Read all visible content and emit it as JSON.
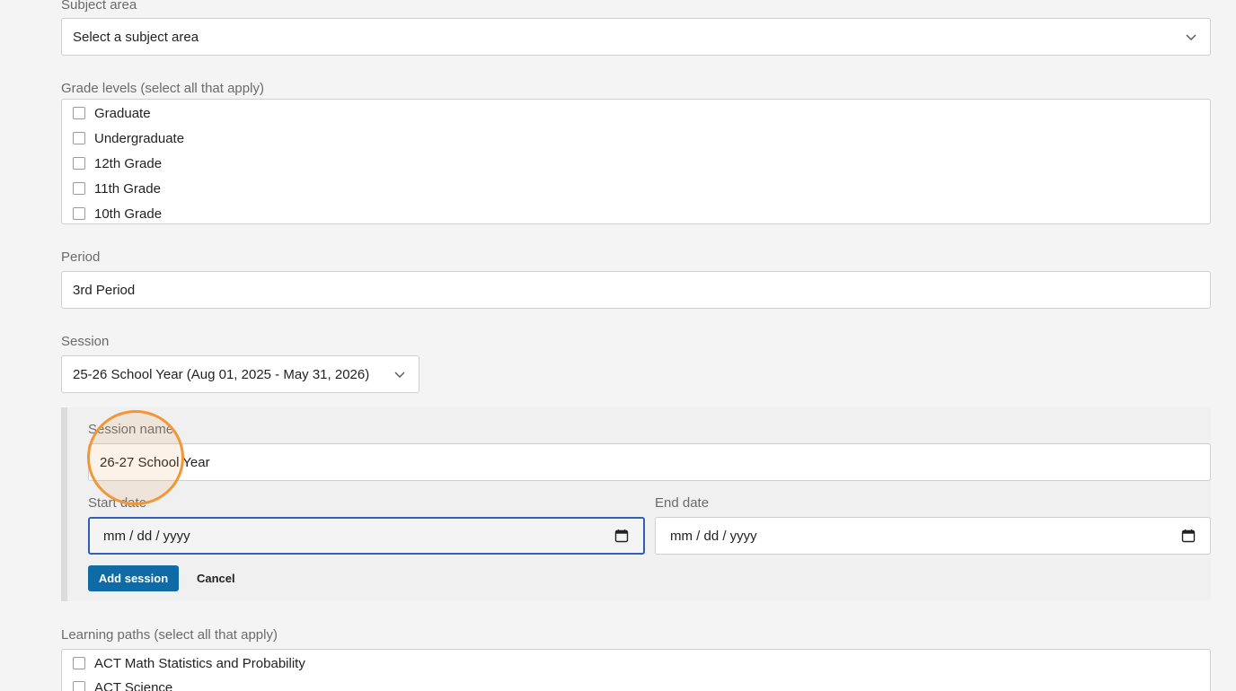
{
  "subject_area": {
    "label": "Subject area",
    "value": "Select a subject area"
  },
  "grade_levels": {
    "label": "Grade levels (select all that apply)",
    "items": [
      "Graduate",
      "Undergraduate",
      "12th Grade",
      "11th Grade",
      "10th Grade"
    ]
  },
  "period": {
    "label": "Period",
    "value": "3rd Period"
  },
  "session": {
    "label": "Session",
    "value": "25-26 School Year (Aug 01, 2025 - May 31, 2026)"
  },
  "new_session": {
    "name_label": "Session name",
    "name_value": "26-27 School Year",
    "start_label": "Start date",
    "start_placeholder": "mm / dd / yyyy",
    "end_label": "End date",
    "end_placeholder": "mm / dd / yyyy",
    "add_button": "Add session",
    "cancel_button": "Cancel"
  },
  "learning_paths": {
    "label": "Learning paths (select all that apply)",
    "items": [
      "ACT Math Statistics and Probability",
      "ACT Science"
    ]
  },
  "colors": {
    "primary_button": "#0f6ba6",
    "focus_border": "#2f5fb8",
    "click_indicator": "#f0973a"
  },
  "icons": [
    "chevron-down-icon",
    "calendar-icon"
  ]
}
